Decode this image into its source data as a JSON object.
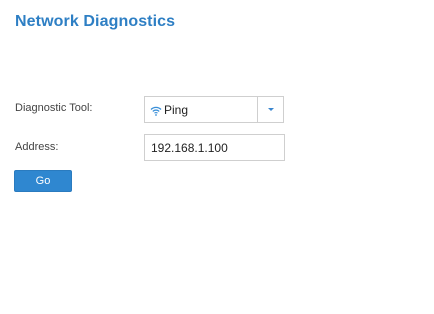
{
  "header": {
    "title": "Network Diagnostics"
  },
  "form": {
    "tool_label": "Diagnostic Tool:",
    "tool_selected": "Ping",
    "tool_icon": "wifi-icon",
    "address_label": "Address:",
    "address_value": "192.168.1.100",
    "go_label": "Go"
  },
  "colors": {
    "accent": "#2e7fc4",
    "button": "#2f87d0",
    "border": "#cfcfcf"
  }
}
